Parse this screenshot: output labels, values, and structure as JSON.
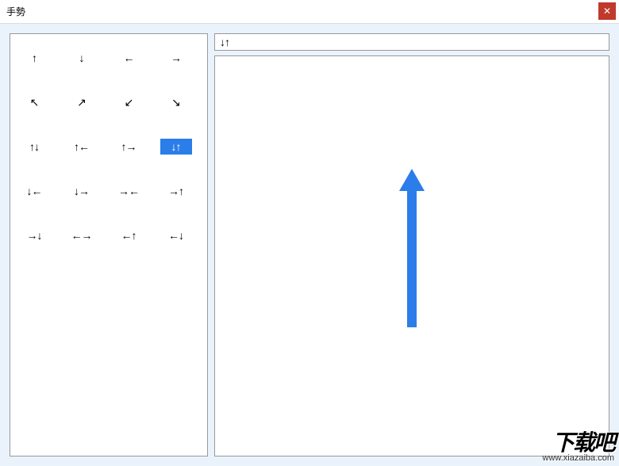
{
  "window": {
    "title": "手勢",
    "close_glyph": "✕"
  },
  "gestures": [
    {
      "id": "up",
      "glyph": "↑"
    },
    {
      "id": "down",
      "glyph": "↓"
    },
    {
      "id": "left",
      "glyph": "←"
    },
    {
      "id": "right",
      "glyph": "→"
    },
    {
      "id": "up-left",
      "glyph": "↖"
    },
    {
      "id": "up-right",
      "glyph": "↗"
    },
    {
      "id": "down-left",
      "glyph": "↙"
    },
    {
      "id": "down-right",
      "glyph": "↘"
    },
    {
      "id": "up-down",
      "glyph": "↑↓"
    },
    {
      "id": "up-left2",
      "glyph": "↑←"
    },
    {
      "id": "up-right2",
      "glyph": "↑→"
    },
    {
      "id": "down-up",
      "glyph": "↓↑",
      "selected": true
    },
    {
      "id": "down-left2",
      "glyph": "↓←"
    },
    {
      "id": "down-right2",
      "glyph": "↓→"
    },
    {
      "id": "right-left",
      "glyph": "→←"
    },
    {
      "id": "right-up",
      "glyph": "→↑"
    },
    {
      "id": "right-down",
      "glyph": "→↓"
    },
    {
      "id": "left-right",
      "glyph": "←→"
    },
    {
      "id": "left-up",
      "glyph": "←↑"
    },
    {
      "id": "left-down",
      "glyph": "←↓"
    }
  ],
  "selected_label": "↓↑",
  "preview": {
    "color": "#2b7de9",
    "stroke_width": 12,
    "direction": "down-up"
  },
  "watermark": {
    "big": "下载吧",
    "small": "www.xiazaiba.com"
  }
}
